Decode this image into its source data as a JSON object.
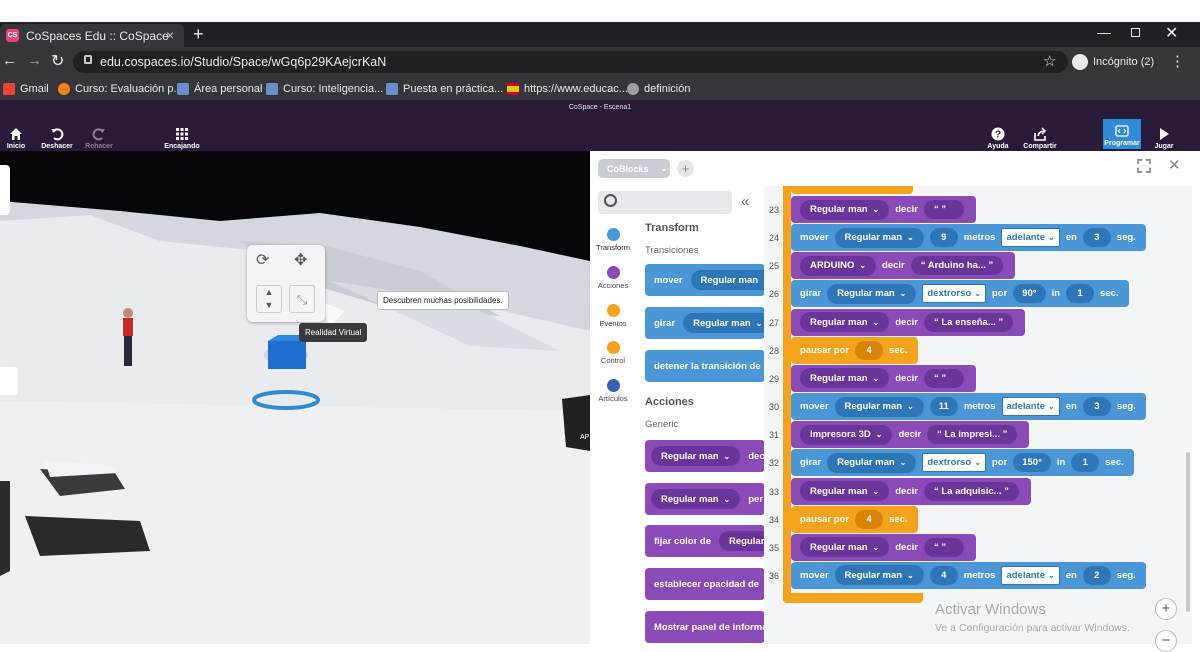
{
  "browser": {
    "tab_title": "CoSpaces Edu :: CoSpace",
    "url": "edu.cospaces.io/Studio/Space/wGq6p29KAejcrKaN",
    "profile_label": "Incógnito (2)",
    "bookmarks": [
      {
        "label": "Gmail",
        "icon": "gmail-icon",
        "color": "#ea4335"
      },
      {
        "label": "Curso: Evaluación p...",
        "icon": "moodle-icon",
        "color": "#f98012"
      },
      {
        "label": "Área personal",
        "icon": "site-icon",
        "color": "#6b8fc9"
      },
      {
        "label": "Curso: Inteligencia...",
        "icon": "site-icon",
        "color": "#6b8fc9"
      },
      {
        "label": "Puesta en práctica...",
        "icon": "site-icon",
        "color": "#6b8fc9"
      },
      {
        "label": "https://www.educac...",
        "icon": "spain-flag-icon",
        "color": "#f5c400"
      },
      {
        "label": "definición",
        "icon": "globe-icon",
        "color": "#9aa0a6"
      }
    ]
  },
  "app": {
    "window_title": "CoSpace - Escena1",
    "toolbar": {
      "home": "Inicio",
      "undo": "Deshacer",
      "redo": "Rehacer",
      "snapping": "Encajando",
      "help": "Ayuda",
      "share": "Compartir",
      "code": "Programar",
      "play": "Jugar"
    },
    "accent": "#2a1a3a",
    "code_button_color": "#2f8bd6"
  },
  "scene": {
    "tooltip_label": "Realidad Virtual",
    "speech_bubble": "Descubren muchas posibilidades."
  },
  "coblocks": {
    "tab_label": "CoBlocks",
    "categories": [
      {
        "label": "Transform",
        "color": "#4a96d6"
      },
      {
        "label": "Acciones",
        "color": "#8a4ab8"
      },
      {
        "label": "Eventos",
        "color": "#f5a21c"
      },
      {
        "label": "Control",
        "color": "#f5a21c"
      },
      {
        "label": "Artículos",
        "color": "#3a5fb8"
      }
    ],
    "palette": {
      "section_transform": "Transform",
      "sub_transitions": "Transiciones",
      "block_move": "mover",
      "block_move_obj": "Regular man",
      "block_turn": "girar",
      "block_turn_obj": "Regular man",
      "block_stop": "detener la transición de",
      "section_actions": "Acciones",
      "sub_generic": "Generic",
      "block_say_obj": "Regular man",
      "block_say_suffix": "dec",
      "block_think_obj": "Regular man",
      "block_think_suffix": "per",
      "block_color": "fijar color de",
      "block_color_obj": "Regular",
      "block_opacity": "establecer opacidad de",
      "block_panel": "Mostrar panel de informac"
    },
    "words": {
      "say": "decir",
      "move": "mover",
      "meters": "metros",
      "in": "en",
      "sec": "seg.",
      "turn": "girar",
      "by": "por",
      "in_short": "in",
      "sec_short": "sec.",
      "pause": "pausar por",
      "forward": "adelante",
      "clockwise": "dextrorso"
    },
    "lines": [
      {
        "n": "23",
        "kind": "say",
        "obj": "Regular man",
        "text": "“  ”"
      },
      {
        "n": "24",
        "kind": "move",
        "obj": "Regular man",
        "dist": "9",
        "dir": "adelante",
        "time": "3"
      },
      {
        "n": "25",
        "kind": "say",
        "obj": "ARDUINO",
        "text": "“ Arduino ha... ”"
      },
      {
        "n": "26",
        "kind": "turn",
        "obj": "Regular man",
        "dir": "dextrorso",
        "deg": "90°",
        "time": "1"
      },
      {
        "n": "27",
        "kind": "say",
        "obj": "Regular man",
        "text": "“ La enseña... ”"
      },
      {
        "n": "28",
        "kind": "pause",
        "time": "4"
      },
      {
        "n": "29",
        "kind": "say",
        "obj": "Regular man",
        "text": "“  ”"
      },
      {
        "n": "30",
        "kind": "move",
        "obj": "Regular man",
        "dist": "11",
        "dir": "adelante",
        "time": "3"
      },
      {
        "n": "31",
        "kind": "say",
        "obj": "Impresora 3D",
        "text": "“ La impresi... ”"
      },
      {
        "n": "32",
        "kind": "turn",
        "obj": "Regular man",
        "dir": "dextrorso",
        "deg": "150°",
        "time": "1"
      },
      {
        "n": "33",
        "kind": "say",
        "obj": "Regular man",
        "text": "“ La adquisic... ”"
      },
      {
        "n": "34",
        "kind": "pause",
        "time": "4"
      },
      {
        "n": "35",
        "kind": "say",
        "obj": "Regular man",
        "text": "“  ”"
      },
      {
        "n": "36",
        "kind": "move",
        "obj": "Regular man",
        "dist": "4",
        "dir": "adelante",
        "time": "2"
      }
    ]
  },
  "watermark": {
    "title": "Activar Windows",
    "subtitle": "Ve a Configuración para activar Windows."
  }
}
